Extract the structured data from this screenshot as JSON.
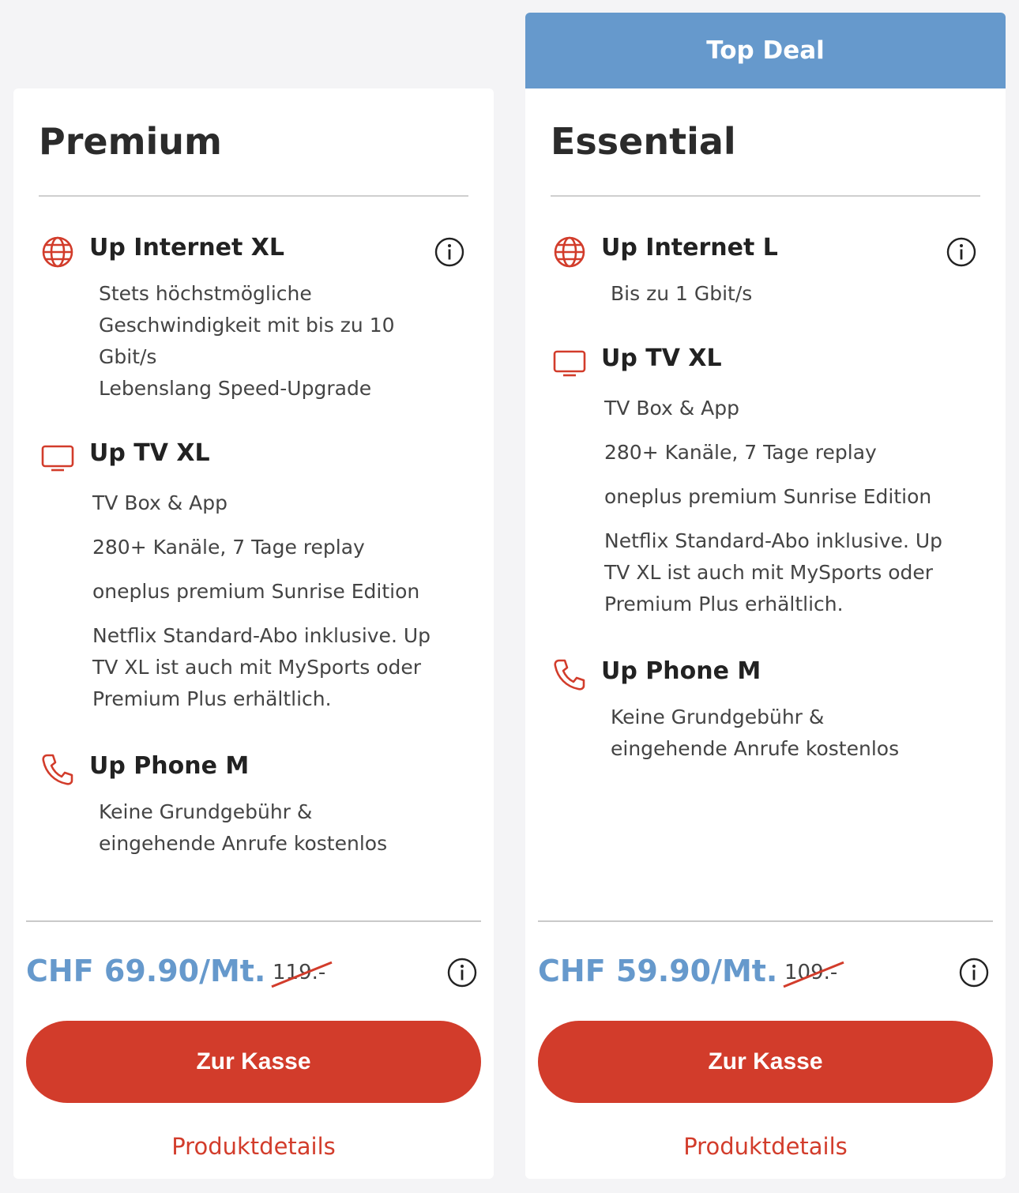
{
  "banner": {
    "label": "Top Deal"
  },
  "colors": {
    "accent_blue": "#6699cc",
    "brand_red": "#d23c2b"
  },
  "cards": [
    {
      "title": "Premium",
      "internet": {
        "icon": "globe-icon",
        "title": "Up Internet XL",
        "lines": [
          "Stets höchstmögliche",
          "Geschwindigkeit mit bis zu 10",
          "Gbit/s",
          "Lebenslang Speed-Upgrade"
        ]
      },
      "tv": {
        "icon": "tv-icon",
        "title": "Up TV XL",
        "l1": "TV Box & App",
        "l2": "280+ Kanäle, 7 Tage replay",
        "l3": "oneplus premium Sunrise Edition",
        "l4": [
          "Netflix Standard-Abo inklusive. Up",
          "TV XL ist auch mit MySports oder",
          "Premium Plus erhältlich."
        ]
      },
      "phone": {
        "icon": "phone-icon",
        "title": "Up Phone M",
        "lines": [
          "Keine Grundgebühr &",
          "eingehende Anrufe kostenlos"
        ]
      },
      "price": "CHF 69.90/Mt.",
      "old_price": "119.-",
      "cta": "Zur Kasse",
      "details": "Produktdetails"
    },
    {
      "title": "Essential",
      "internet": {
        "icon": "globe-icon",
        "title": "Up Internet L",
        "lines": [
          "Bis zu 1 Gbit/s"
        ]
      },
      "tv": {
        "icon": "tv-icon",
        "title": "Up TV XL",
        "l1": "TV Box & App",
        "l2": "280+ Kanäle, 7 Tage replay",
        "l3": "oneplus premium Sunrise Edition",
        "l4": [
          "Netflix Standard-Abo inklusive. Up",
          "TV XL ist auch mit MySports oder",
          "Premium Plus erhältlich."
        ]
      },
      "phone": {
        "icon": "phone-icon",
        "title": "Up Phone M",
        "lines": [
          "Keine Grundgebühr &",
          "eingehende Anrufe kostenlos"
        ]
      },
      "price": "CHF 59.90/Mt.",
      "old_price": "109.-",
      "cta": "Zur Kasse",
      "details": "Produktdetails"
    }
  ]
}
